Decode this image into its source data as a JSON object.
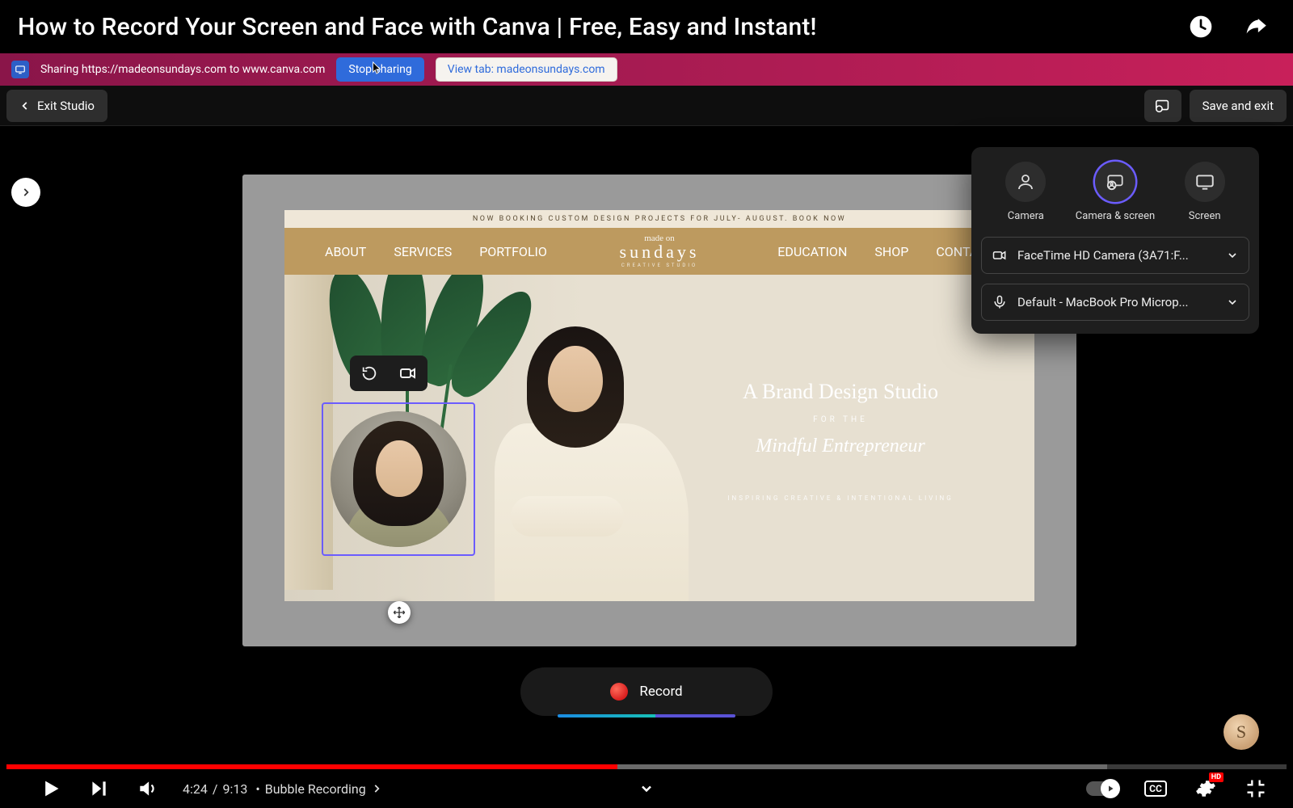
{
  "title": "How to Record Your Screen and Face with Canva | Free, Easy and Instant!",
  "share_strip": {
    "text": "Sharing https://madeonsundays.com to www.canva.com",
    "stop_label": "Stop sharing",
    "view_label": "View tab: madeonsundays.com"
  },
  "toolbar": {
    "exit_label": "Exit Studio",
    "save_label": "Save and exit"
  },
  "site": {
    "announcement": "NOW BOOKING CUSTOM DESIGN PROJECTS FOR JULY- AUGUST. BOOK NOW",
    "logo_script": "made on",
    "logo_main": "sundays",
    "logo_sub": "CREATIVE STUDIO",
    "nav_left": [
      "ABOUT",
      "SERVICES",
      "PORTFOLIO"
    ],
    "nav_right": [
      "EDUCATION",
      "SHOP",
      "CONTACT"
    ],
    "hero_line1": "A Brand Design Studio",
    "hero_line2": "FOR THE",
    "hero_line3": "Mindful Entrepreneur",
    "hero_tag": "INSPIRING CREATIVE & INTENTIONAL LIVING"
  },
  "record": {
    "label": "Record"
  },
  "settings": {
    "modes": {
      "camera": "Camera",
      "camera_screen": "Camera & screen",
      "screen": "Screen"
    },
    "camera_select": "FaceTime HD Camera (3A71:F...",
    "mic_select": "Default - MacBook Pro Microp..."
  },
  "channel": {
    "initial": "S"
  },
  "player": {
    "current": "4:24",
    "duration": "9:13",
    "separator": "/",
    "chapter_prefix": "•",
    "chapter": "Bubble Recording",
    "played_pct": 47.7,
    "buffered_start_pct": 47.7,
    "buffered_end_pct": 86,
    "hd_label": "HD",
    "cc_label": "CC"
  }
}
